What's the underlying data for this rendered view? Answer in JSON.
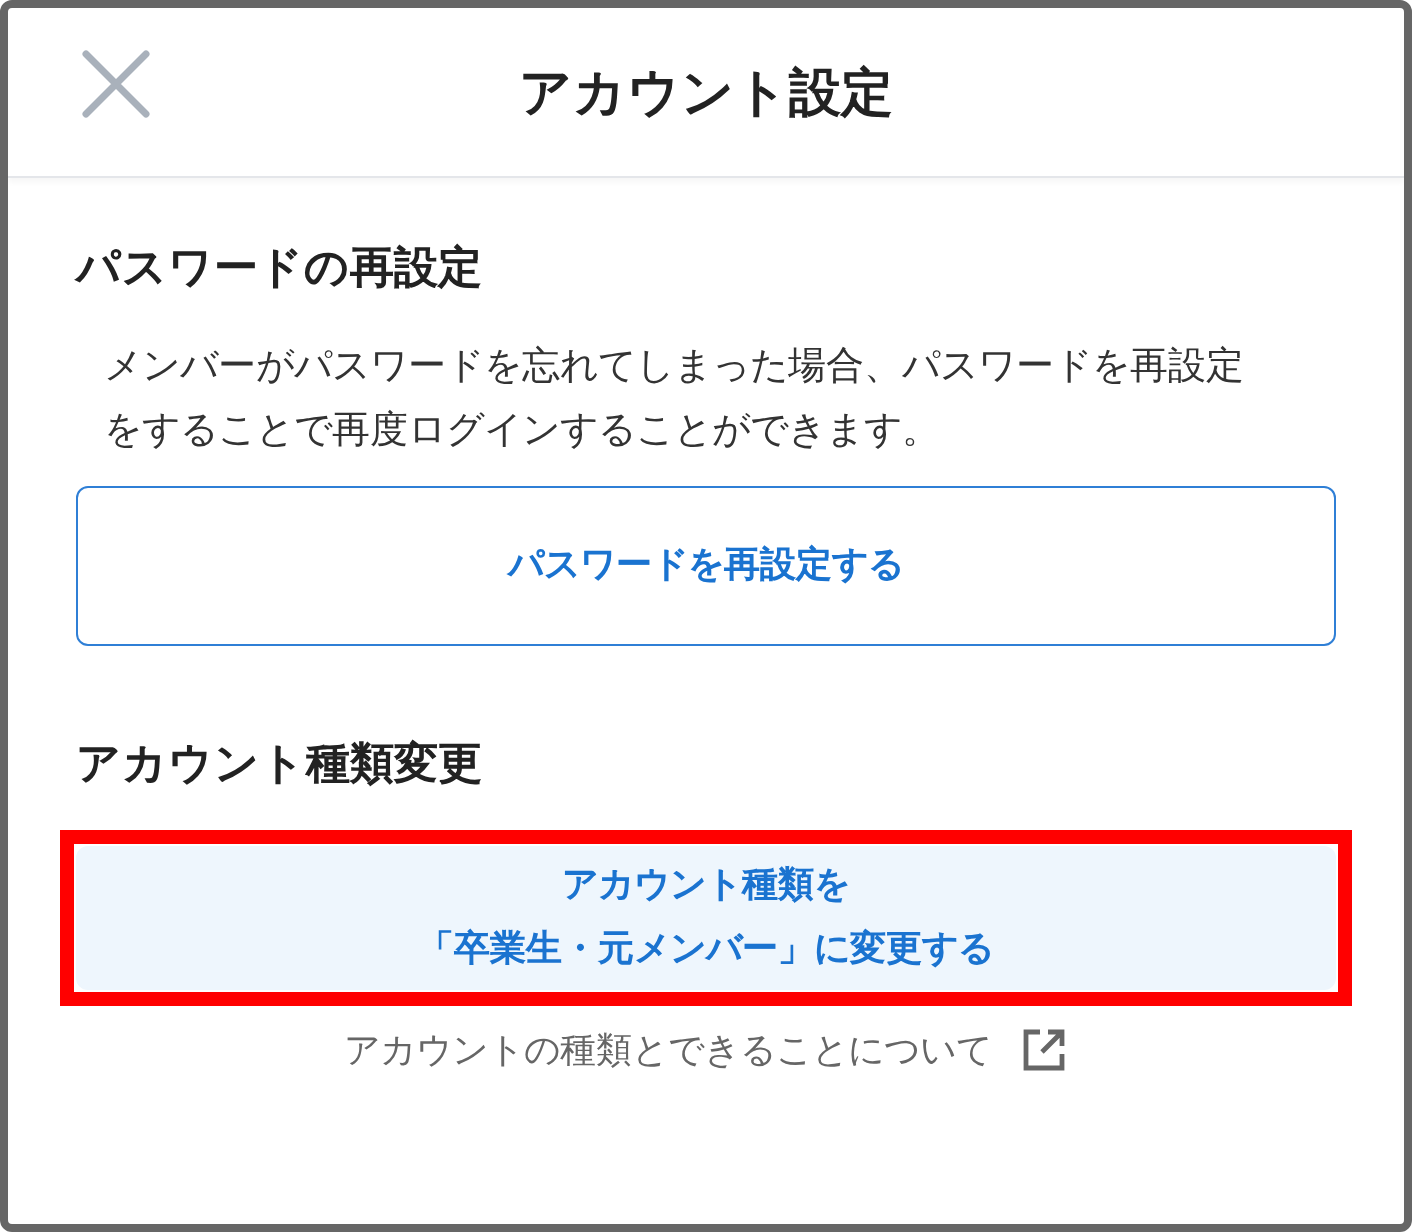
{
  "header": {
    "title": "アカウント設定"
  },
  "sections": [
    {
      "title": "パスワードの再設定",
      "description": "メンバーがパスワードを忘れてしまった場合、パスワードを再設定をすることで再度ログインすることができます。",
      "button": {
        "label": "パスワードを再設定する",
        "kind": "outline",
        "highlighted": false
      }
    },
    {
      "title": "アカウント種類変更",
      "button": {
        "label_lines": [
          "アカウント種類を",
          "「卒業生・元メンバー」に変更する"
        ],
        "kind": "filled",
        "highlighted": true
      },
      "link": {
        "label": "アカウントの種類とできることについて",
        "external": true
      }
    }
  ]
}
